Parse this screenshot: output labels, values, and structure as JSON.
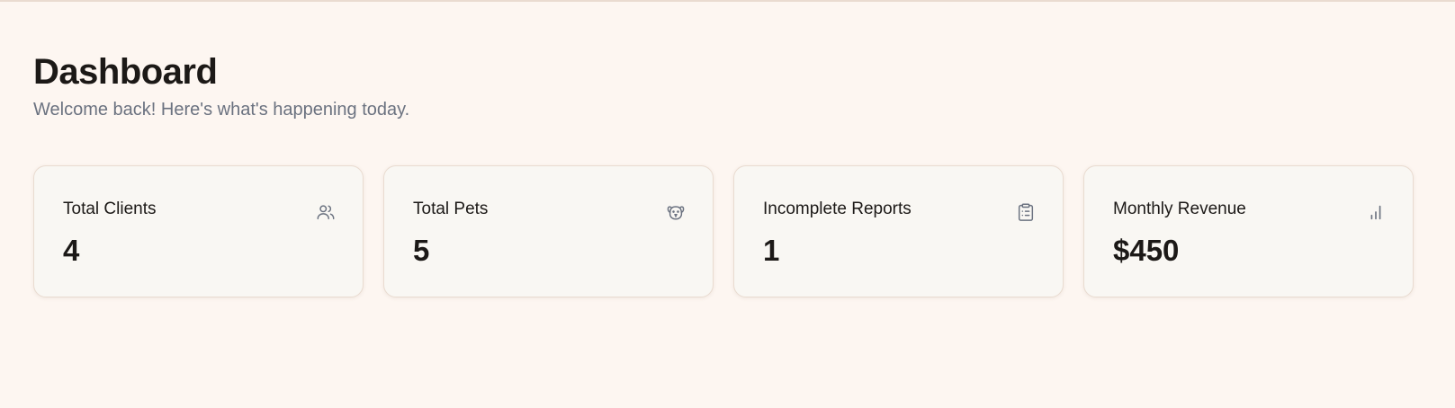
{
  "header": {
    "title": "Dashboard",
    "subtitle": "Welcome back! Here's what's happening today."
  },
  "stats": [
    {
      "label": "Total Clients",
      "value": "4",
      "icon": "users-icon"
    },
    {
      "label": "Total Pets",
      "value": "5",
      "icon": "dog-icon"
    },
    {
      "label": "Incomplete Reports",
      "value": "1",
      "icon": "clipboard-list-icon"
    },
    {
      "label": "Monthly Revenue",
      "value": "$450",
      "icon": "bar-chart-icon"
    }
  ],
  "colors": {
    "background": "#fdf6f1",
    "card_background": "#f9f7f3",
    "card_border": "#e9dbd0",
    "text_primary": "#1c1917",
    "text_muted": "#6b7280"
  }
}
